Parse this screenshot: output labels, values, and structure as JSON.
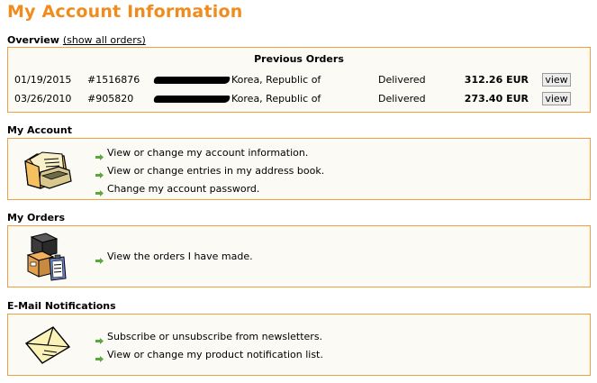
{
  "page": {
    "title": "My Account Information"
  },
  "overview": {
    "heading": "Overview",
    "show_all_link": "(show all orders)",
    "previous_orders_title": "Previous Orders",
    "orders": [
      {
        "date": "01/19/2015",
        "number": "#1516876",
        "country": "Korea, Republic of",
        "status": "Delivered",
        "total": "312.26 EUR",
        "button": "view"
      },
      {
        "date": "03/26/2010",
        "number": "#905820",
        "country": "Korea, Republic of",
        "status": "Delivered",
        "total": "273.40 EUR",
        "button": "view"
      }
    ]
  },
  "my_account": {
    "heading": "My Account",
    "icon": "folder-documents-icon",
    "links": [
      "View or change my account information.",
      "View or change entries in my address book.",
      "Change my account password."
    ]
  },
  "my_orders": {
    "heading": "My Orders",
    "icon": "boxes-clipboard-icon",
    "links": [
      "View the orders I have made."
    ]
  },
  "email_notifications": {
    "heading": "E-Mail Notifications",
    "icon": "envelope-icon",
    "links": [
      "Subscribe or unsubscribe from newsletters.",
      "View or change my product notification list."
    ]
  },
  "colors": {
    "accent": "#f08c1e",
    "box_border": "#f0a040",
    "box_bg": "#fbfaf5",
    "arrow": "#5aa83c"
  }
}
